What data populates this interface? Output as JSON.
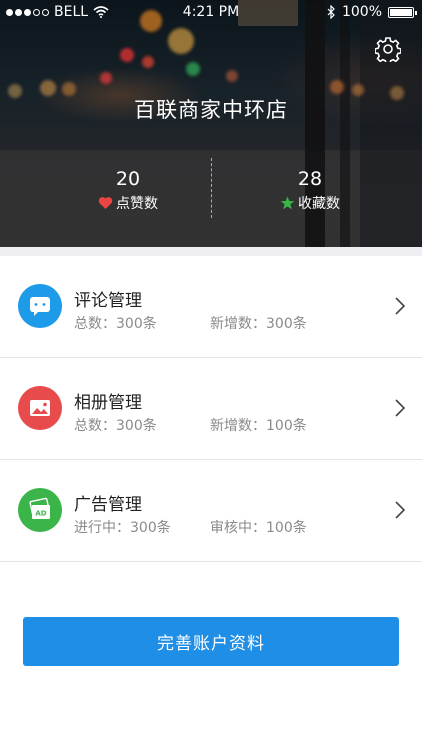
{
  "status_bar": {
    "carrier": "BELL",
    "time": "4:21 PM",
    "battery": "100%"
  },
  "header": {
    "settings_icon": "gear-icon",
    "store_name": "百联商家中环店",
    "stats": {
      "likes": {
        "value": "20",
        "label": "点赞数",
        "icon": "heart-icon",
        "color": "#e94545"
      },
      "favorites": {
        "value": "28",
        "label": "收藏数",
        "icon": "star-icon",
        "color": "#3bb54a"
      }
    }
  },
  "sections": [
    {
      "title": "评论管理",
      "icon": "comment-icon",
      "color": "#1e9be8",
      "stat1": "总数：300条",
      "stat2": "新增数：300条"
    },
    {
      "title": "相册管理",
      "icon": "photo-icon",
      "color": "#e84b4b",
      "stat1": "总数：300条",
      "stat2": "新增数：100条"
    },
    {
      "title": "广告管理",
      "icon": "ad-icon",
      "color": "#3bb54a",
      "stat1": "进行中：300条",
      "stat2": "审核中：100条"
    }
  ],
  "cta": {
    "label": "完善账户资料",
    "color": "#1e8ee6"
  }
}
